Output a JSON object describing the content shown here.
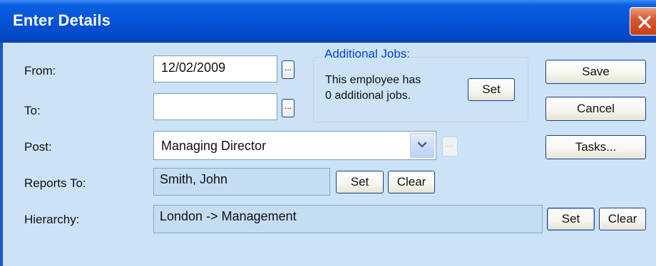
{
  "window": {
    "title": "Enter Details"
  },
  "form": {
    "from": {
      "label": "From:",
      "value": "12/02/2009",
      "browse_label": "..."
    },
    "to": {
      "label": "To:",
      "value": "",
      "browse_label": "..."
    },
    "post": {
      "label": "Post:",
      "value": "Managing Director",
      "browse_label": "..."
    },
    "reports_to": {
      "label": "Reports To:",
      "value": "Smith, John",
      "set_label": "Set",
      "clear_label": "Clear"
    },
    "hierarchy": {
      "label": "Hierarchy:",
      "value": "London -> Management",
      "set_label": "Set",
      "clear_label": "Clear"
    }
  },
  "additional_jobs": {
    "title": "Additional Jobs:",
    "line1": "This employee has",
    "line2": "0 additional jobs.",
    "set_label": "Set"
  },
  "actions": {
    "save_label": "Save",
    "cancel_label": "Cancel",
    "tasks_label": "Tasks..."
  },
  "icons": {
    "close": "close-icon",
    "dropdown": "chevron-down-icon"
  },
  "colors": {
    "titlebar": "#0553d6",
    "dialog_bg": "#cce2f7",
    "close_button": "#d9592e",
    "group_title": "#0046d5"
  }
}
